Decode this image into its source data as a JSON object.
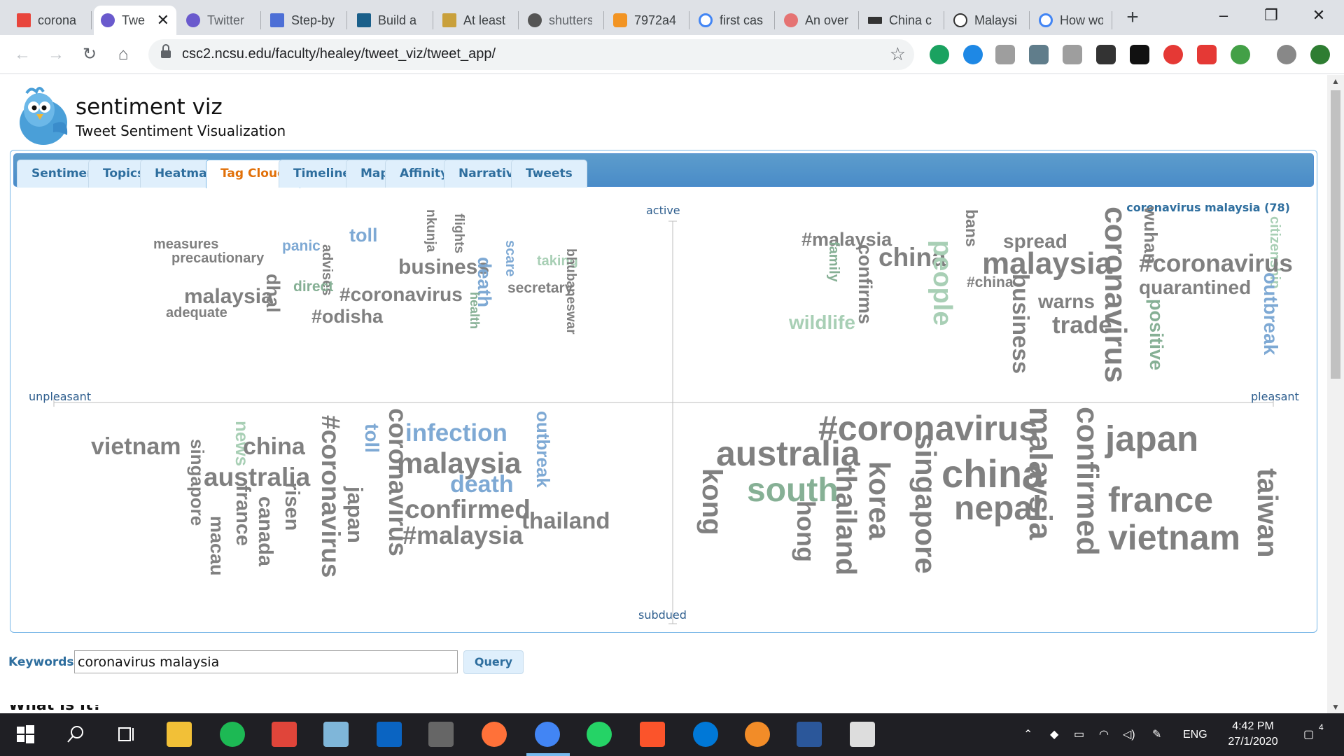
{
  "tabs": [
    {
      "title": "corona",
      "color": "#e8453c"
    },
    {
      "title": "Twe",
      "color": "#6a5acd",
      "active": true
    },
    {
      "title": "Twitter",
      "color": "#6a5acd"
    },
    {
      "title": "Step-by",
      "color": "#4d6fd6"
    },
    {
      "title": "Build a",
      "color": "#1a5f8a"
    },
    {
      "title": "At least",
      "color": "#c9a03b"
    },
    {
      "title": "shutters",
      "color": "#555555"
    },
    {
      "title": "7972a4",
      "color": "#f29423"
    },
    {
      "title": "first cas",
      "color": "#4285f4"
    },
    {
      "title": "An over",
      "color": "#e57373"
    },
    {
      "title": "China c",
      "color": "#333333"
    },
    {
      "title": "Malaysi",
      "color": "#333333"
    },
    {
      "title": "How wo",
      "color": "#4285f4"
    }
  ],
  "browser": {
    "url": "csc2.ncsu.edu/faculty/healey/tweet_viz/tweet_app/",
    "new_tab": "+",
    "minimize": "–",
    "restore": "❐",
    "close": "✕",
    "back": "←",
    "forward": "→",
    "reload": "↻",
    "home": "⌂",
    "bookmark": "☆",
    "tab_close": "✕"
  },
  "extensions": [
    "#1aa260",
    "#1e88e5",
    "#9e9e9e",
    "#607d8b",
    "#9e9e9e",
    "#333333",
    "#111111",
    "#e53935",
    "#e53935",
    "#43a047",
    "#888888",
    "#2e7d32"
  ],
  "app": {
    "title": "sentiment viz",
    "subtitle": "Tweet Sentiment Visualization"
  },
  "nav_tabs": [
    "Sentiment",
    "Topics",
    "Heatmap",
    "Tag Cloud",
    "Timeline",
    "Map",
    "Affinity",
    "Narrative",
    "Tweets"
  ],
  "active_tab": "Tag Cloud",
  "cloud": {
    "query_label": "coronavirus malaysia (78)",
    "axis": {
      "top": "active",
      "bottom": "subdued",
      "left": "unpleasant",
      "right": "pleasant"
    },
    "words": [
      "measures",
      "precautionary",
      "panic",
      "toll",
      "advises",
      "nkunja",
      "flights",
      "scare",
      "taking",
      "bhubaneswar",
      "business",
      "death",
      "secretary",
      "malaysia",
      "dhal",
      "direct",
      "#coronavirus",
      "health",
      "adequate",
      "#odisha",
      "#malaysia",
      "bans",
      "spread",
      "coronavirus",
      "wuhan",
      "citizenship",
      "family",
      "confirms",
      "china",
      "people",
      "malaysia",
      "#coronavirus",
      "#china",
      "business",
      "warns",
      "quarantined",
      "outbreak",
      "positive",
      "wildlife",
      "trade",
      "vietnam",
      "singapore",
      "news",
      "china",
      "#coronavirus",
      "toll",
      "coronavirus",
      "infection",
      "malaysia",
      "outbreak",
      "death",
      "australia",
      "france",
      "risen",
      "canada",
      "macau",
      "japan",
      "confirmed",
      "#malaysia",
      "thailand",
      "#coronavirus",
      "australia",
      "malaysia",
      "confirmed",
      "japan",
      "singapore",
      "korea",
      "kong",
      "south",
      "thailand",
      "hong",
      "china",
      "nepal",
      "france",
      "vietnam",
      "taiwan"
    ]
  },
  "keywords": {
    "label": "Keywords:",
    "value": "coronavirus malaysia",
    "button": "Query"
  },
  "cut_heading": "What Is It?",
  "taskbar": {
    "lang": "ENG",
    "time": "4:42 PM",
    "date": "27/1/2020",
    "notifications": "4"
  }
}
